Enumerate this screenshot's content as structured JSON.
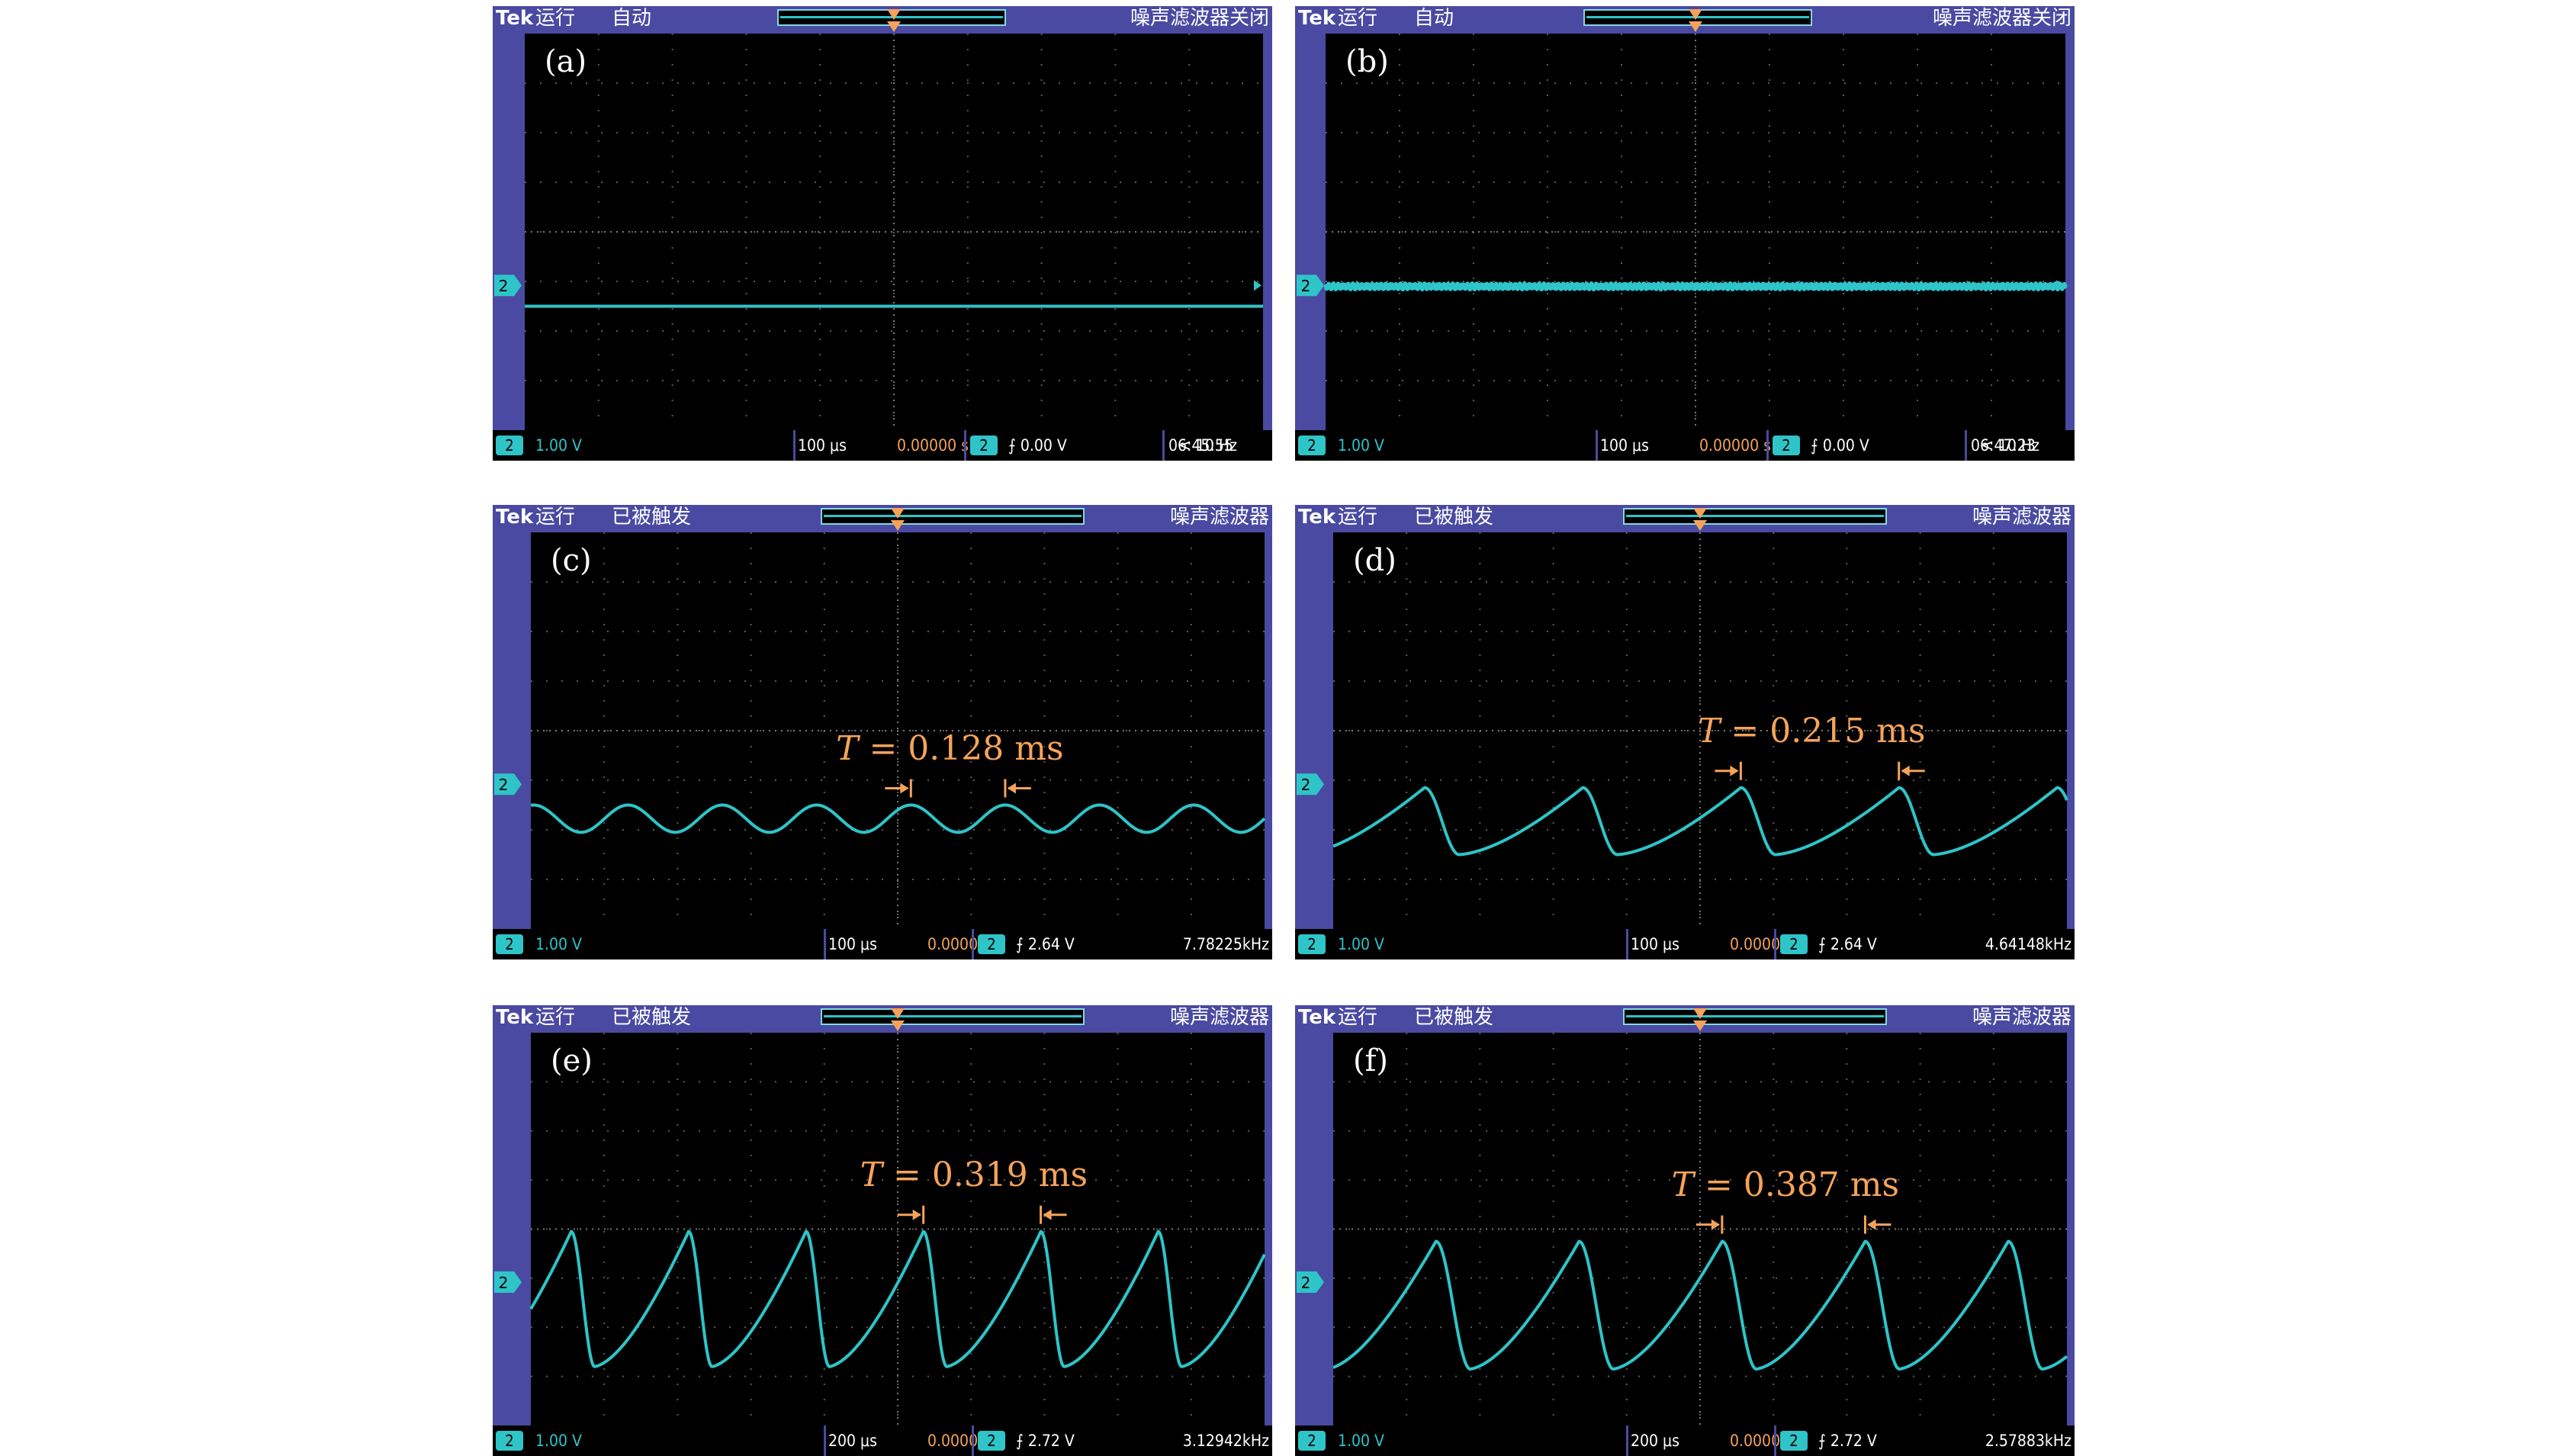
{
  "colors": {
    "frame": "#4a4aa2",
    "screen": "#000000",
    "trace": "#2ec4c8",
    "grid": "#5a5a5a",
    "marker": "#f5a35a",
    "time_text": "#f5a35a"
  },
  "chart_data": [
    {
      "type": "line",
      "panel": "(a)",
      "status_top": {
        "brand": "Tek",
        "run": "运行",
        "mode": "自动",
        "filter": "噪声滤波器关闭"
      },
      "status_bottom": {
        "channel": "2",
        "volts_div": "1.00 V",
        "time_div": "100 μs",
        "trigger_pos": "0.00000 s",
        "trigger_channel": "2",
        "trigger_level": "0.00 V",
        "frequency": "< 10 Hz",
        "clock": "06:45:55"
      },
      "waveform": "dc",
      "level_div": 2.5,
      "time_div_us": 100,
      "grid": true,
      "period": null,
      "annotation": ""
    },
    {
      "type": "line",
      "panel": "(b)",
      "status_top": {
        "brand": "Tek",
        "run": "运行",
        "mode": "自动",
        "filter": "噪声滤波器关闭"
      },
      "status_bottom": {
        "channel": "2",
        "volts_div": "1.00 V",
        "time_div": "100 μs",
        "trigger_pos": "0.00000 s",
        "trigger_channel": "2",
        "trigger_level": "0.00 V",
        "frequency": "< 10 Hz",
        "clock": "06:47:23"
      },
      "waveform": "dc_noisy",
      "level_div": 2.9,
      "time_div_us": 100,
      "grid": true,
      "period": null,
      "annotation": ""
    },
    {
      "type": "line",
      "panel": "(c)",
      "status_top": {
        "brand": "Tek",
        "run": "运行",
        "mode": "已被触发",
        "filter": "噪声滤波器"
      },
      "status_bottom": {
        "channel": "2",
        "volts_div": "1.00 V",
        "time_div": "100 μs",
        "trigger_pos": "0.00000 s",
        "trigger_channel": "2",
        "trigger_level": "2.64 V",
        "frequency": "7.78225kHz",
        "clock": ""
      },
      "waveform": "sine",
      "period_div": 1.285,
      "min_div": 1.95,
      "max_div": 2.5,
      "peak_time_div": 0.18,
      "time_div_us": 100,
      "grid": true,
      "period": {
        "label": "T",
        "value": "= 0.128 ms",
        "ms": 0.128
      },
      "annotation": "T = 0.128 ms"
    },
    {
      "type": "line",
      "panel": "(d)",
      "status_top": {
        "brand": "Tek",
        "run": "运行",
        "mode": "已被触发",
        "filter": "噪声滤波器"
      },
      "status_bottom": {
        "channel": "2",
        "volts_div": "1.00 V",
        "time_div": "100 μs",
        "trigger_pos": "0.00000 s",
        "trigger_channel": "2",
        "trigger_level": "2.64 V",
        "frequency": "4.64148kHz",
        "clock": ""
      },
      "waveform": "relaxation",
      "period_div": 2.155,
      "min_div": 1.5,
      "max_div": 2.85,
      "fall_fraction": 0.22,
      "peak_time_div": -1.6,
      "time_div_us": 100,
      "grid": true,
      "period": {
        "label": "T",
        "value": "= 0.215 ms",
        "ms": 0.215
      },
      "annotation": "T = 0.215 ms"
    },
    {
      "type": "line",
      "panel": "(e)",
      "status_top": {
        "brand": "Tek",
        "run": "运行",
        "mode": "已被触发",
        "filter": "噪声滤波器"
      },
      "status_bottom": {
        "channel": "2",
        "volts_div": "1.00 V",
        "time_div": "200 μs",
        "trigger_pos": "0.00000 s",
        "trigger_channel": "2",
        "trigger_level": "2.72 V",
        "frequency": "3.12942kHz",
        "clock": ""
      },
      "waveform": "relaxation",
      "period_div": 1.6,
      "min_div": 1.2,
      "max_div": 3.95,
      "fall_fraction": 0.2,
      "peak_time_div": -1.25,
      "time_div_us": 200,
      "grid": true,
      "period": {
        "label": "T",
        "value": "= 0.319 ms",
        "ms": 0.319
      },
      "annotation": "T = 0.319 ms"
    },
    {
      "type": "line",
      "panel": "(f)",
      "status_top": {
        "brand": "Tek",
        "run": "运行",
        "mode": "已被触发",
        "filter": "噪声滤波器"
      },
      "status_bottom": {
        "channel": "2",
        "volts_div": "1.00 V",
        "time_div": "200 μs",
        "trigger_pos": "0.00000 s",
        "trigger_channel": "2",
        "trigger_level": "2.72 V",
        "frequency": "2.57883kHz",
        "clock": ""
      },
      "waveform": "relaxation",
      "period_div": 1.95,
      "min_div": 1.15,
      "max_div": 3.75,
      "fall_fraction": 0.24,
      "peak_time_div": -1.65,
      "time_div_us": 200,
      "grid": true,
      "period": {
        "label": "T",
        "value": "= 0.387 ms",
        "ms": 0.387
      },
      "annotation": "T = 0.387 ms"
    }
  ]
}
